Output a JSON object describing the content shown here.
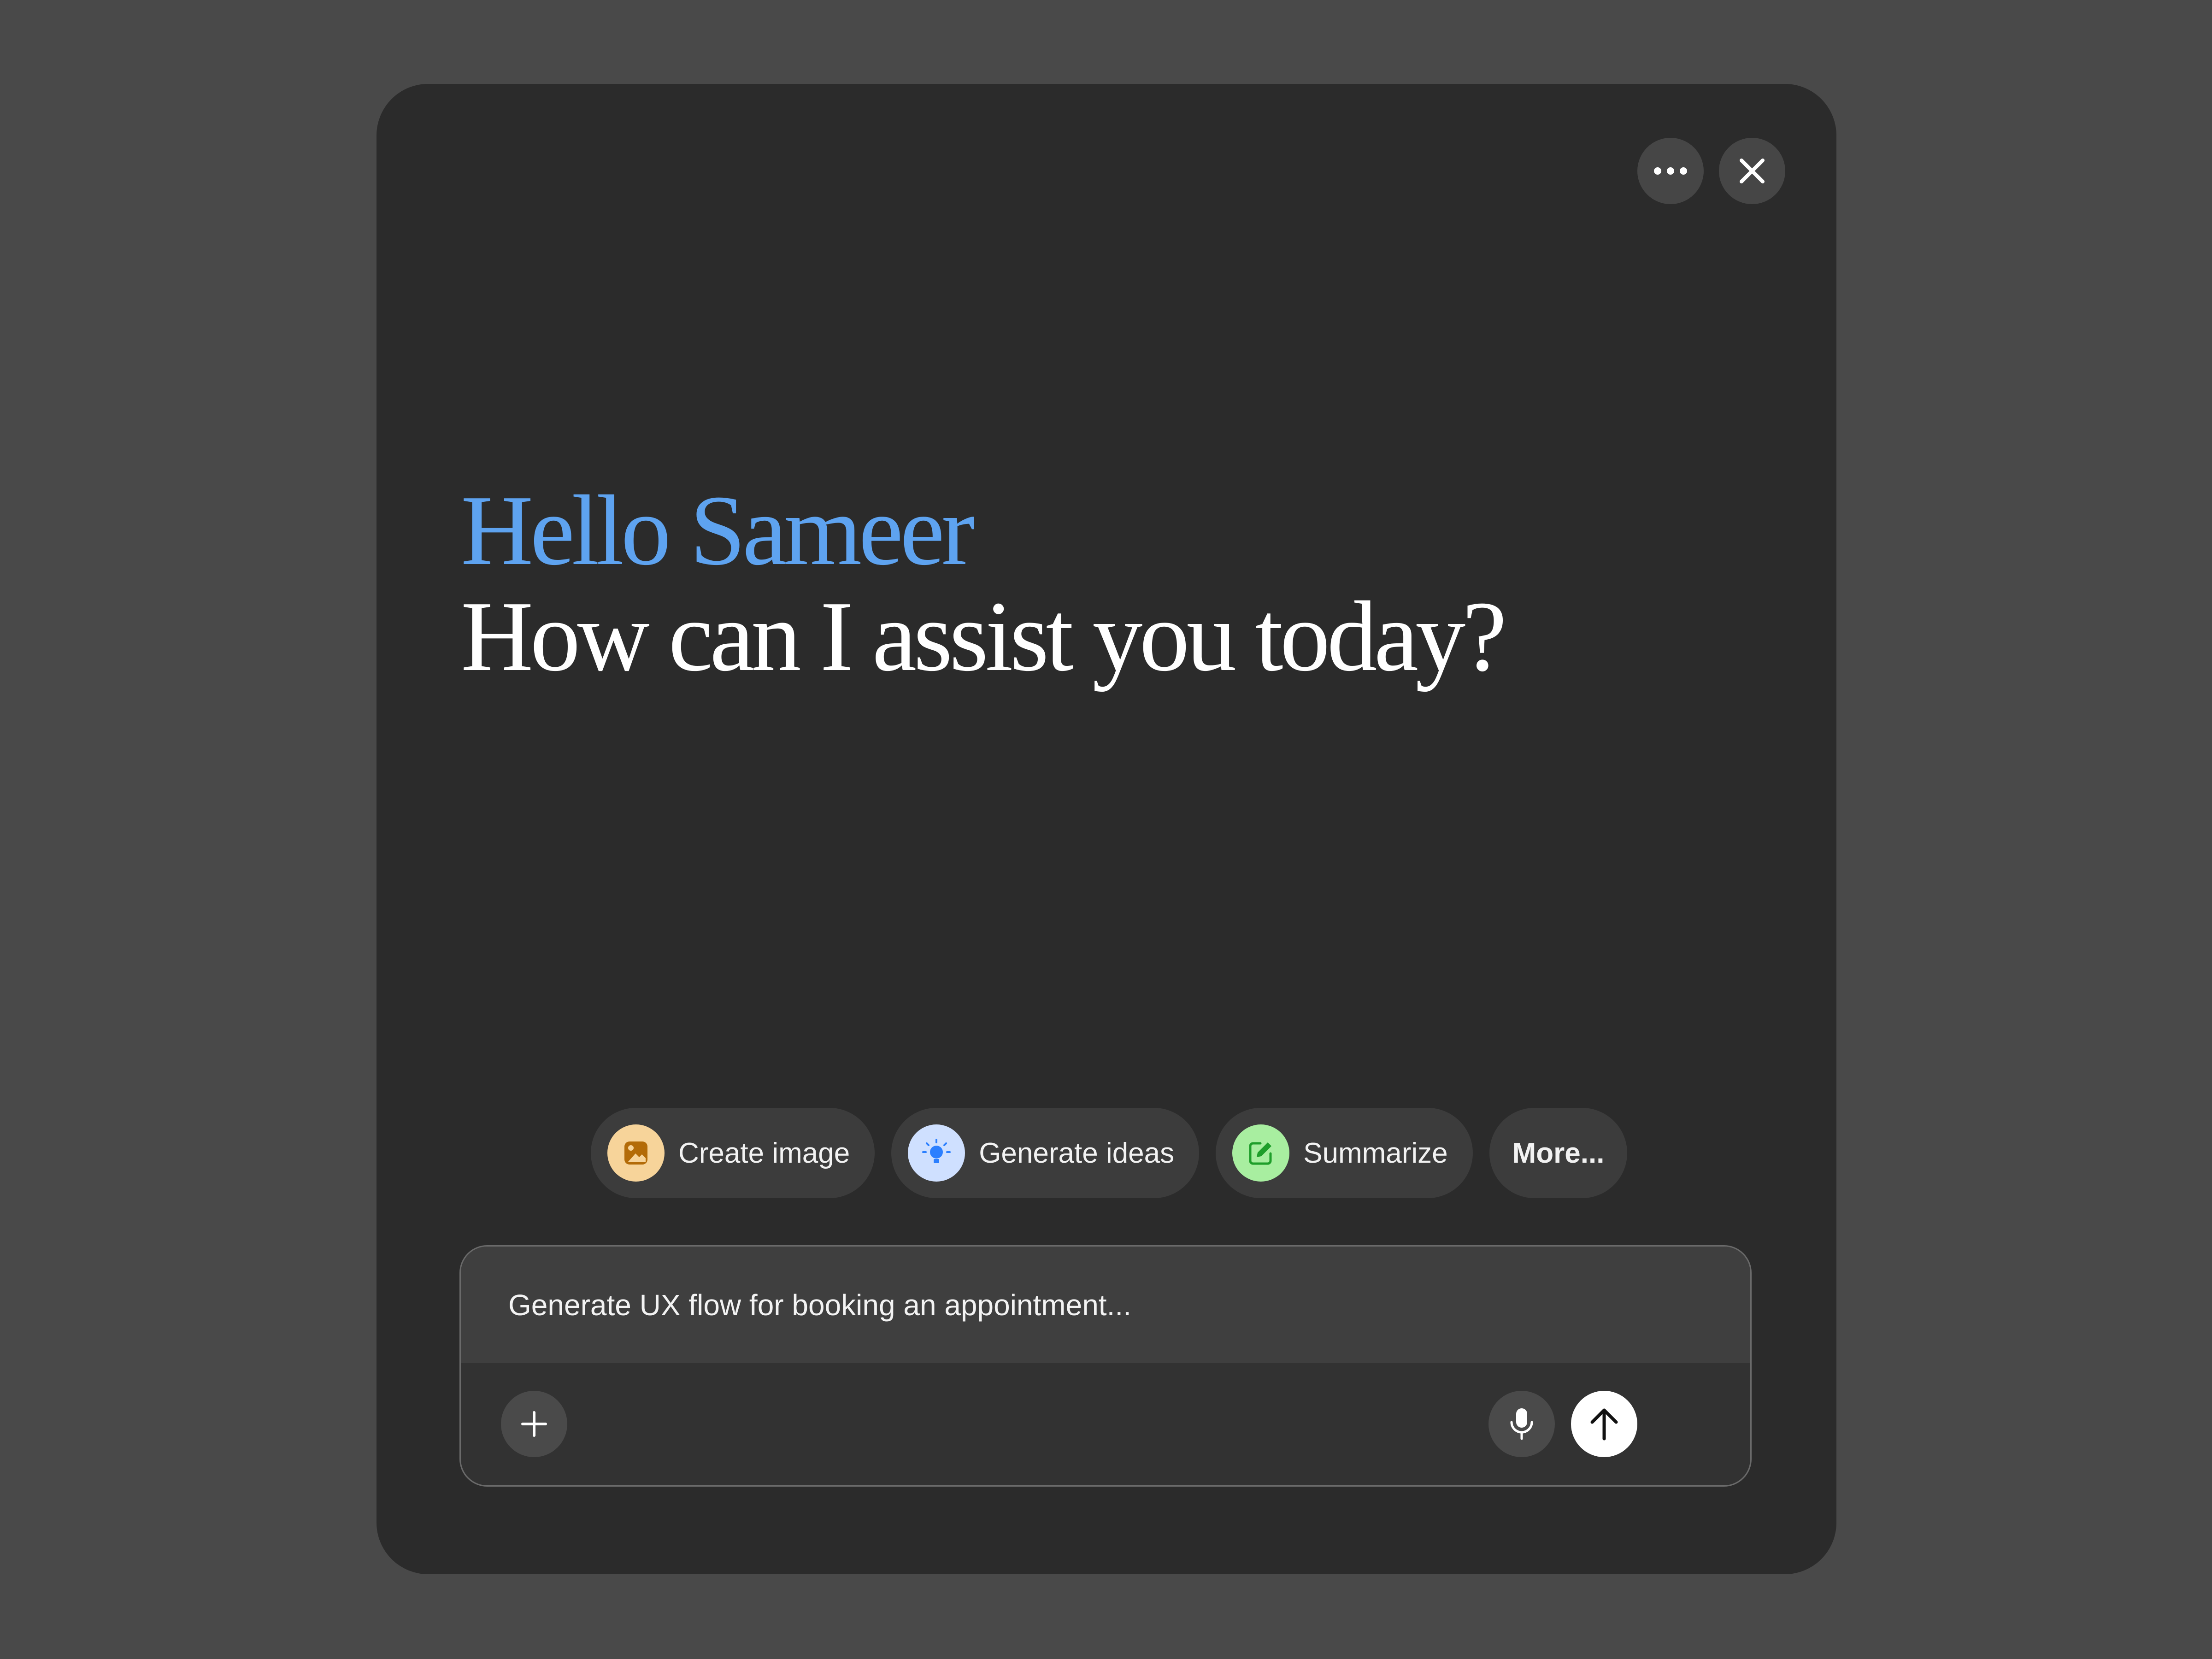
{
  "header": {
    "more_icon": "ellipsis-icon",
    "close_icon": "close-icon"
  },
  "greeting": {
    "name_line": "Hello Sameer",
    "question_line": "How can I assist you today?",
    "name_color": "#5ea3f0"
  },
  "suggestions": [
    {
      "label": "Create image",
      "icon": "image-icon",
      "icon_bg": "#f7d49a",
      "icon_color": "#b36b08"
    },
    {
      "label": "Generate ideas",
      "icon": "lightbulb-icon",
      "icon_bg": "#cfe0ff",
      "icon_color": "#2b7fff"
    },
    {
      "label": "Summarize",
      "icon": "edit-icon",
      "icon_bg": "#a8eea0",
      "icon_color": "#1e9e2a"
    },
    {
      "label": "More..."
    }
  ],
  "composer": {
    "input_text": "Generate UX flow for booking an appointment...",
    "add_icon": "plus-icon",
    "mic_icon": "microphone-icon",
    "send_icon": "arrow-up-icon"
  }
}
